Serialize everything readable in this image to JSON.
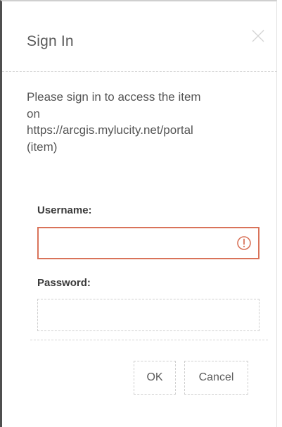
{
  "dialog": {
    "title": "Sign In",
    "close_icon": "close-icon",
    "message_lines": [
      "Please sign in to access the item",
      "on",
      "https://arcgis.mylucity.net/portal",
      "(item)"
    ]
  },
  "form": {
    "username": {
      "label": "Username:",
      "value": "",
      "placeholder": "",
      "status": "error",
      "status_icon": "error-icon"
    },
    "password": {
      "label": "Password:",
      "value": "",
      "placeholder": ""
    }
  },
  "buttons": {
    "ok_label": "OK",
    "cancel_label": "Cancel"
  },
  "colors": {
    "error": "#d9735a",
    "text": "#555555",
    "frame": "#4f4f4f"
  }
}
